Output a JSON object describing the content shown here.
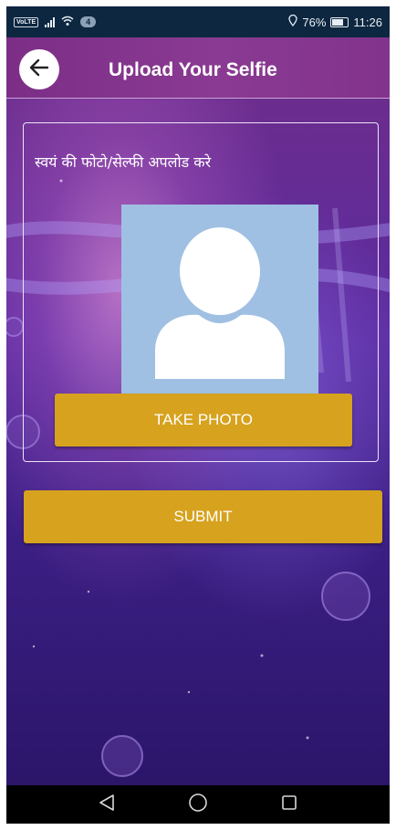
{
  "status_bar": {
    "network_label": "VoLTE",
    "notification_count": "4",
    "battery_percent": "76%",
    "time": "11:26",
    "icons": [
      "volte-icon",
      "signal-icon",
      "wifi-icon",
      "location-icon",
      "battery-icon"
    ]
  },
  "header": {
    "title": "Upload Your Selfie",
    "back_icon": "arrow-left-icon",
    "background_color": "#853590"
  },
  "upload": {
    "instruction": "स्वयं की फोटो/सेल्फी अपलोड करे",
    "placeholder_icon": "user-silhouette-icon",
    "placeholder_background": "#9fc0e3",
    "take_photo_label": "TAKE PHOTO"
  },
  "actions": {
    "submit_label": "SUBMIT",
    "button_color": "#d7a21e"
  },
  "navigation": {
    "icons": [
      "back-triangle-icon",
      "home-circle-icon",
      "recents-square-icon"
    ]
  }
}
